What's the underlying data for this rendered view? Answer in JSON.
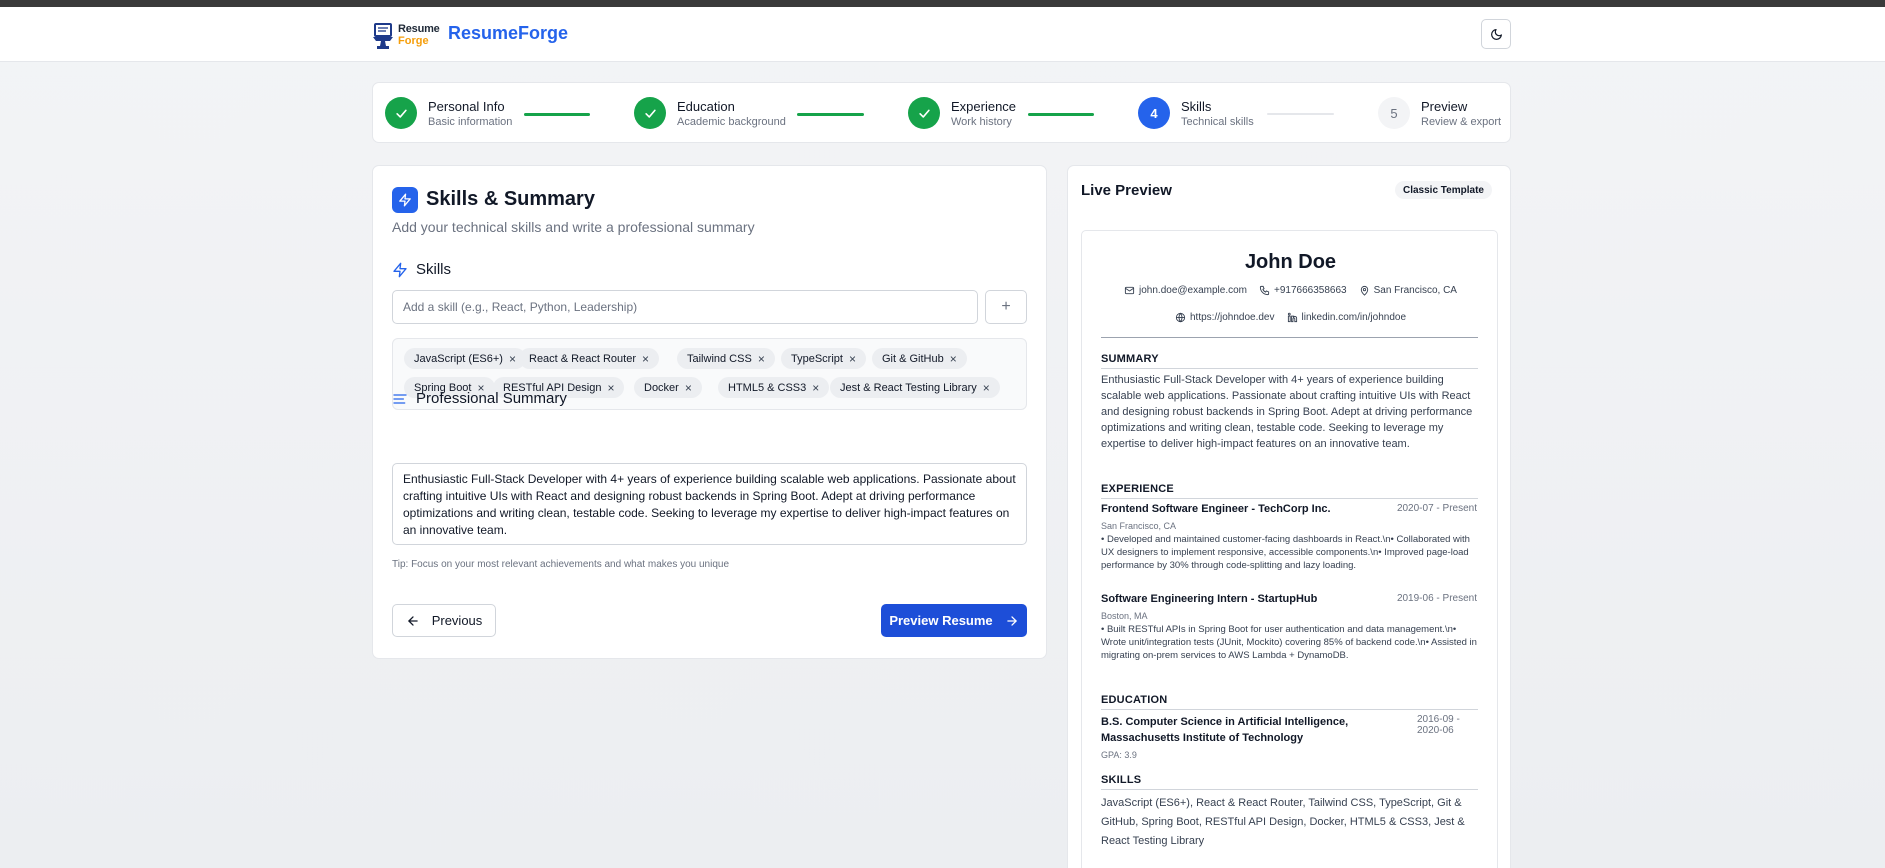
{
  "header": {
    "logo_text_1": "Resume",
    "logo_text_2": "Forge",
    "brand": "ResumeForge",
    "theme_toggle_icon": "moon-icon"
  },
  "steps": [
    {
      "title": "Personal Info",
      "subtitle": "Basic information",
      "state": "done"
    },
    {
      "title": "Education",
      "subtitle": "Academic background",
      "state": "done"
    },
    {
      "title": "Experience",
      "subtitle": "Work history",
      "state": "done"
    },
    {
      "title": "Skills",
      "subtitle": "Technical skills",
      "state": "active",
      "number": "4"
    },
    {
      "title": "Preview",
      "subtitle": "Review & export",
      "state": "todo",
      "number": "5"
    }
  ],
  "form": {
    "title": "Skills & Summary",
    "subtitle": "Add your technical skills and write a professional summary",
    "skills_heading": "Skills",
    "skill_input_placeholder": "Add a skill (e.g., React, Python, Leadership)",
    "add_button_symbol": "+",
    "skills": [
      "JavaScript (ES6+)",
      "React & React Router",
      "Tailwind CSS",
      "TypeScript",
      "Git & GitHub",
      "Spring Boot",
      "RESTful API Design",
      "Docker",
      "HTML5 & CSS3",
      "Jest & React Testing Library"
    ],
    "summary_heading": "Professional Summary",
    "summary_text": "Enthusiastic Full-Stack Developer with 4+ years of experience building scalable web applications. Passionate about crafting intuitive UIs with React and designing robust backends in Spring Boot. Adept at driving performance optimizations and writing clean, testable code. Seeking to leverage my expertise to deliver high-impact features on an innovative team.",
    "tip": "Tip: Focus on your most relevant achievements and what makes you unique",
    "previous_label": "Previous",
    "next_label": "Preview Resume"
  },
  "preview": {
    "title": "Live Preview",
    "template_badge": "Classic Template",
    "name": "John Doe",
    "email": "john.doe@example.com",
    "phone": "+917666358663",
    "location": "San Francisco, CA",
    "website": "https://johndoe.dev",
    "linkedin": "linkedin.com/in/johndoe",
    "summary_title": "SUMMARY",
    "summary": "Enthusiastic Full-Stack Developer with 4+ years of experience building scalable web applications. Passionate about crafting intuitive UIs with React and designing robust backends in Spring Boot. Adept at driving performance optimizations and writing clean, testable code. Seeking to leverage my expertise to deliver high-impact features on an innovative team.",
    "experience_title": "EXPERIENCE",
    "jobs": [
      {
        "title": "Frontend Software Engineer - TechCorp Inc.",
        "dates": "2020-07 - Present",
        "location": "San Francisco, CA",
        "description": "• Developed and maintained customer-facing dashboards in React.\\n• Collaborated with UX designers to implement responsive, accessible components.\\n• Improved page-load performance by 30% through code-splitting and lazy loading."
      },
      {
        "title": "Software Engineering Intern - StartupHub",
        "dates": "2019-06 - Present",
        "location": "Boston, MA",
        "description": "• Built RESTful APIs in Spring Boot for user authentication and data management.\\n• Wrote unit/integration tests (JUnit, Mockito) covering 85% of backend code.\\n• Assisted in migrating on-prem services to AWS Lambda + DynamoDB."
      }
    ],
    "education_title": "EDUCATION",
    "degree": "B.S. Computer Science in Artificial Intelligence, Massachusetts Institute of Technology",
    "edu_dates_1": "2016-09 -",
    "edu_dates_2": "2020-06",
    "gpa": "GPA: 3.9",
    "skills_title": "SKILLS",
    "skills_text": "JavaScript (ES6+), React & React Router, Tailwind CSS, TypeScript, Git & GitHub, Spring Boot, RESTful API Design, Docker, HTML5 & CSS3, Jest & React Testing Library"
  },
  "colors": {
    "accent": "#2563eb",
    "success": "#16a34a",
    "logo_accent": "#f59e0b"
  }
}
